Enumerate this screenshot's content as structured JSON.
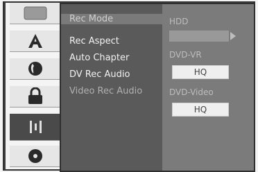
{
  "sidebar": {
    "items": [
      {
        "name": "tv-icon",
        "active": false
      },
      {
        "name": "font-a-icon",
        "active": false
      },
      {
        "name": "globe-icon",
        "active": false
      },
      {
        "name": "lock-icon",
        "active": false
      },
      {
        "name": "recording-icon",
        "active": true
      },
      {
        "name": "disc-icon",
        "active": false
      }
    ]
  },
  "menu": {
    "items": [
      {
        "label": "Rec Mode",
        "state": "highlighted"
      },
      {
        "label": "Rec Aspect",
        "state": "normal"
      },
      {
        "label": "Auto Chapter",
        "state": "normal"
      },
      {
        "label": "DV Rec Audio",
        "state": "normal"
      },
      {
        "label": "Video Rec Audio",
        "state": "dim"
      }
    ]
  },
  "options": {
    "hdd_label": "HDD",
    "dvdvr_label": "DVD-VR",
    "dvdvr_value": "HQ",
    "dvdvideo_label": "DVD-Video",
    "dvdvideo_value": "HQ"
  },
  "colors": {
    "menu_bg": "#5a5a5a",
    "options_bg": "#7b7b7b",
    "highlight": "#7a7a7a",
    "value_box": "#efefef"
  }
}
